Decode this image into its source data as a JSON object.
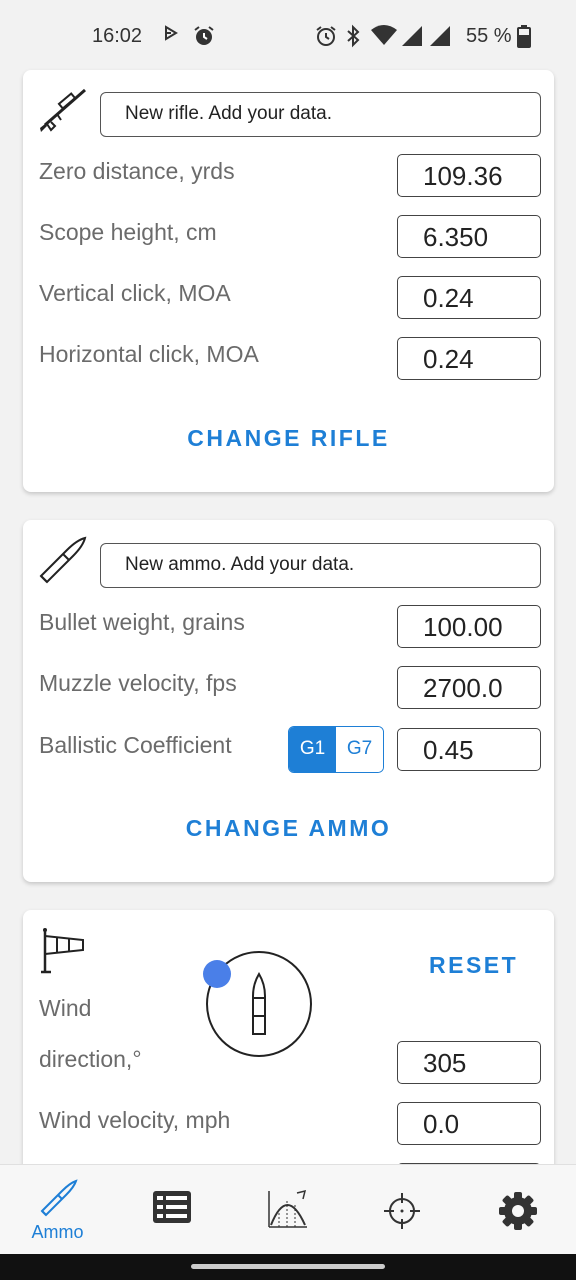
{
  "status_bar": {
    "time": "16:02",
    "battery": "55 %",
    "icons": [
      "play-icon",
      "alarm-icon",
      "alarm-icon",
      "bluetooth-icon",
      "wifi-icon",
      "signal-icon",
      "signal-icon",
      "battery-icon"
    ]
  },
  "rifle": {
    "icon": "rifle-icon",
    "name": "New rifle. Add your data.",
    "rows": [
      {
        "label": "Zero distance, yrds",
        "value": "109.36"
      },
      {
        "label": "Scope height, cm",
        "value": "6.350"
      },
      {
        "label": "Vertical click, MOA",
        "value": "0.24"
      },
      {
        "label": "Horizontal click, MOA",
        "value": "0.24"
      }
    ],
    "change_label": "CHANGE RIFLE"
  },
  "ammo": {
    "icon": "bullet-icon",
    "name": "New ammo. Add your data.",
    "rows": [
      {
        "label": "Bullet weight, grains",
        "value": "100.00"
      },
      {
        "label": "Muzzle velocity, fps",
        "value": "2700.0"
      },
      {
        "label": "Ballistic Coefficient",
        "value": "0.45"
      }
    ],
    "drag_model": {
      "options": [
        "G1",
        "G7"
      ],
      "selected": "G1"
    },
    "change_label": "CHANGE AMMO"
  },
  "wind": {
    "icon": "windsock-icon",
    "reset_label": "RESET",
    "direction_label_line1": "Wind",
    "direction_label_line2": "direction,°",
    "direction_value": "305",
    "velocity_label": "Wind velocity, mph",
    "velocity_value": "0.0"
  },
  "nav": {
    "items": [
      {
        "icon": "ammo-icon",
        "label": "Ammo",
        "active": true
      },
      {
        "icon": "list-icon",
        "label": "",
        "active": false
      },
      {
        "icon": "trajectory-icon",
        "label": "",
        "active": false
      },
      {
        "icon": "crosshair-icon",
        "label": "",
        "active": false
      },
      {
        "icon": "gear-icon",
        "label": "",
        "active": false
      }
    ]
  },
  "colors": {
    "accent": "#1e7fd6",
    "label_gray": "#6b6b6b",
    "dial_handle": "#4a7fe8"
  }
}
